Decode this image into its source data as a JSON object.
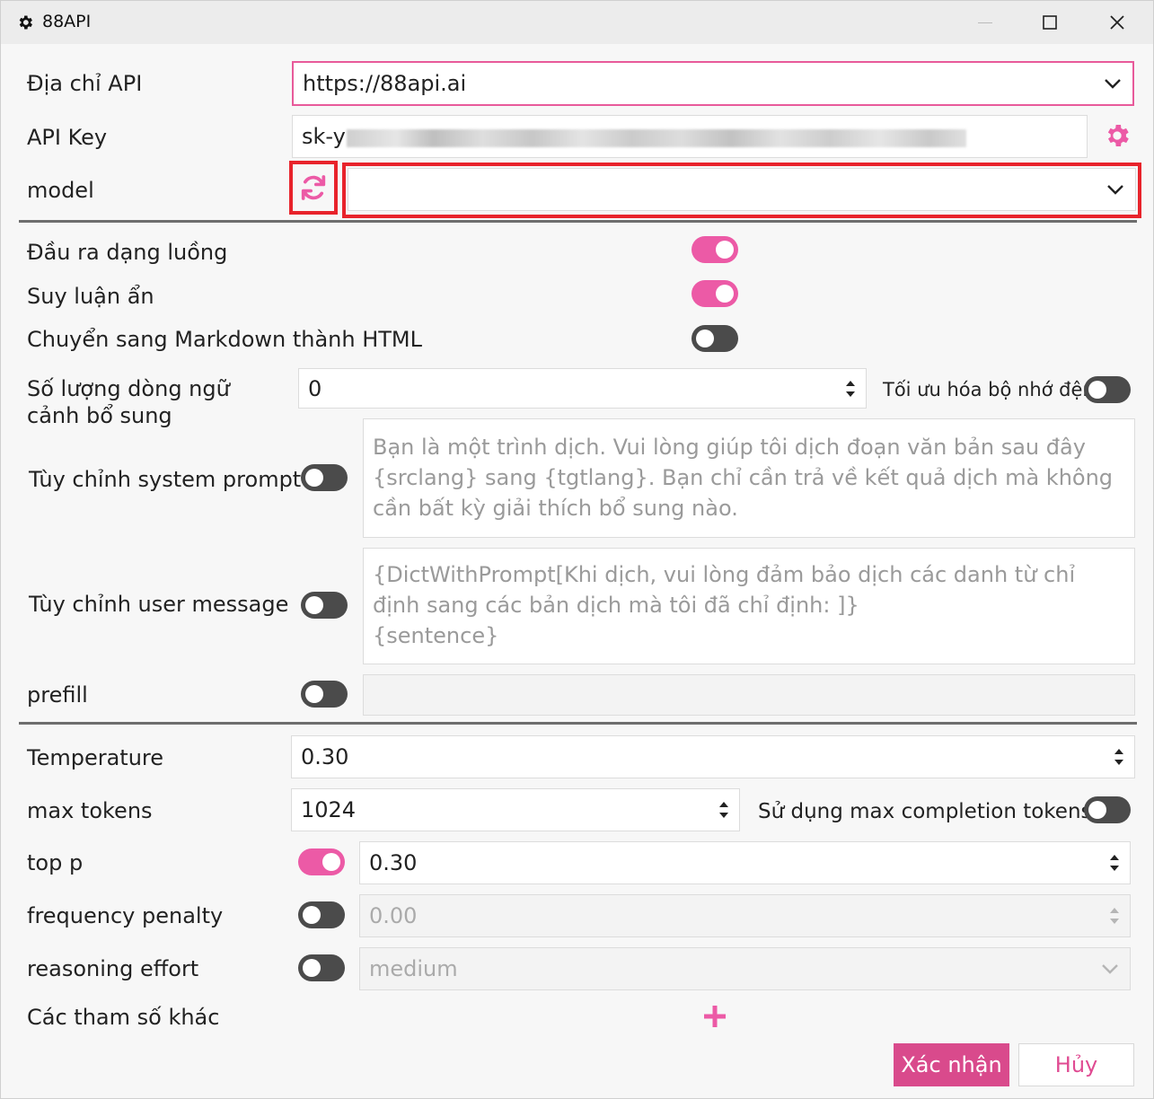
{
  "window": {
    "title": "88API",
    "icon": "gear-icon"
  },
  "form": {
    "api_address": {
      "label": "Địa chỉ API",
      "value": "https://88api.ai"
    },
    "api_key": {
      "label": "API Key",
      "value": "sk-y",
      "settings_icon": "gear-icon"
    },
    "model": {
      "label": "model",
      "value": "",
      "refresh_icon": "refresh-icon"
    },
    "stream_output": {
      "label": "Đầu ra dạng luồng",
      "on": true
    },
    "hidden_reasoning": {
      "label": "Suy luận ẩn",
      "on": true
    },
    "markdown_to_html": {
      "label": "Chuyển sang Markdown thành HTML",
      "on": false
    },
    "context_lines": {
      "label": "Số lượng dòng ngữ cảnh bổ sung",
      "value": "0"
    },
    "cache_optimization": {
      "label": "Tối ưu hóa bộ nhớ đệm",
      "on": false
    },
    "system_prompt": {
      "label": "Tùy chỉnh system prompt",
      "on": false,
      "placeholder": "Bạn là một trình dịch. Vui lòng giúp tôi dịch đoạn văn bản sau đây {srclang} sang {tgtlang}. Bạn chỉ cần trả về kết quả dịch mà không cần bất kỳ giải thích bổ sung nào."
    },
    "user_message": {
      "label": "Tùy chỉnh user message",
      "on": false,
      "placeholder": "{DictWithPrompt[Khi dịch, vui lòng đảm bảo dịch các danh từ chỉ định sang các bản dịch mà tôi đã chỉ định: ]}\n{sentence}"
    },
    "prefill": {
      "label": "prefill",
      "on": false,
      "value": ""
    },
    "temperature": {
      "label": "Temperature",
      "value": "0.30"
    },
    "max_tokens": {
      "label": "max tokens",
      "value": "1024"
    },
    "max_completion_tokens": {
      "label": "Sử dụng max completion tokens",
      "on": false
    },
    "top_p": {
      "label": "top p",
      "on": true,
      "value": "0.30"
    },
    "frequency_penalty": {
      "label": "frequency penalty",
      "on": false,
      "value": "0.00"
    },
    "reasoning_effort": {
      "label": "reasoning effort",
      "on": false,
      "value": "medium"
    },
    "other_params": {
      "label": "Các tham số khác",
      "add_icon": "plus-icon"
    }
  },
  "buttons": {
    "confirm": "Xác nhận",
    "cancel": "Hủy"
  },
  "colors": {
    "accent": "#ec5aa6",
    "highlight": "#e8232b",
    "primary_button": "#d94a8c"
  }
}
